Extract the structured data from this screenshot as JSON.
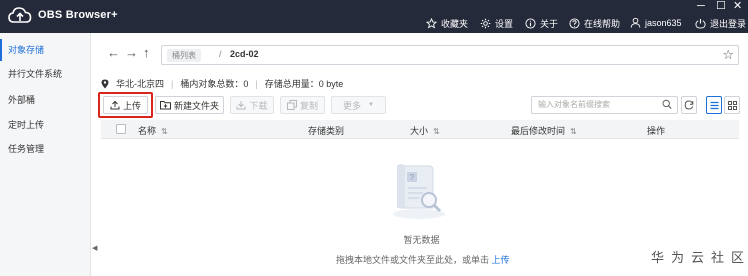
{
  "app": {
    "title": "OBS Browser+"
  },
  "header": {
    "favorites": "收藏夹",
    "settings": "设置",
    "about": "关于",
    "help": "在线帮助",
    "user": "jason635",
    "logout": "退出登录",
    "window_controls": {
      "minimize": "─",
      "maximize": "☐",
      "close": "✕"
    }
  },
  "sidebar": {
    "items": [
      {
        "label": "对象存储",
        "active": true
      },
      {
        "label": "并行文件系统",
        "active": false
      },
      {
        "label": "外部桶",
        "active": false
      },
      {
        "label": "定时上传",
        "active": false
      },
      {
        "label": "任务管理",
        "active": false
      }
    ],
    "collapse_glyph": "◀"
  },
  "pathbar": {
    "root": "桶列表",
    "separator": "/",
    "current": "2cd-02"
  },
  "info": {
    "region": "华北-北京四",
    "object_count": "桶内对象总数：0",
    "storage_used": "存储总用量：0 byte"
  },
  "toolbar": {
    "upload": "上传",
    "new_folder": "新建文件夹",
    "download": "下载",
    "copy": "复制",
    "more": "更多",
    "search_placeholder": "输入对象名前缀搜索"
  },
  "table": {
    "columns": [
      "名称",
      "存储类别",
      "大小",
      "最后修改时间",
      "操作"
    ]
  },
  "empty": {
    "text": "暂无数据",
    "drop_hint": "拖拽本地文件或文件夹至此处，或单击",
    "upload_link": "上传"
  },
  "watermark": "华为云社区"
}
